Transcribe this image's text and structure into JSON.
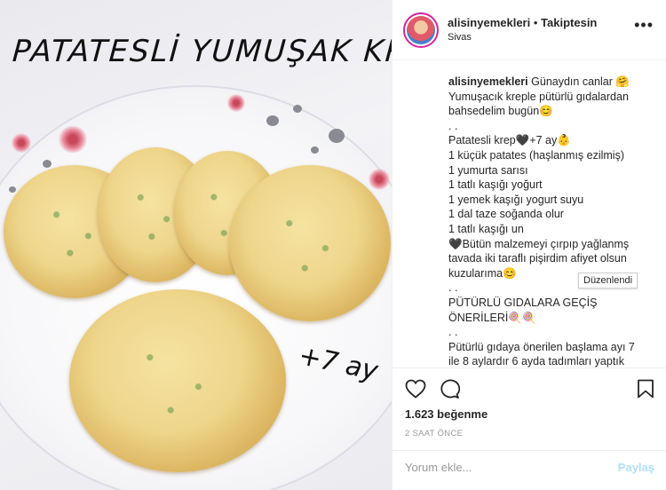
{
  "photo": {
    "title": "PATATESLİ YUMUŞAK KREP",
    "age_note": "+7 ay"
  },
  "post_header": {
    "username": "alisinyemekleri",
    "separator": "•",
    "follow_status": "Takiptesin",
    "location": "Sivas",
    "more_icon": "more-dots-icon"
  },
  "caption": {
    "username": "alisinyemekleri",
    "lines": [
      "Günaydın canlar 🤗",
      "Yumuşacık kreple pütürlü gıdalardan",
      "bahsedelim bugün😊",
      ". .",
      "Patatesli krep🖤+7 ay👶",
      "1 küçük patates (haşlanmış ezilmiş)",
      "1 yumurta sarısı",
      "1 tatlı kaşığı yoğurt",
      "1 yemek kaşığı yogurt suyu",
      "1 dal taze soğanda olur",
      "1 tatlı kaşığı un",
      "🖤Bütün malzemeyi çırpıp yağlanmş",
      "tavada iki taraflı pişirdim afiyet olsun",
      "kuzularıma😊",
      ". .",
      "PÜTÜRLÜ GIDALARA GEÇİŞ",
      "ÖNERİLERİ🍭🍭",
      ". .",
      "Pütürlü gıdaya önerilen başlama ayı 7",
      "ile 8 aylardır 6 ayda tadımları yaptık"
    ]
  },
  "edited_badge": "Düzenlendi",
  "actions": {
    "like_icon": "heart-icon",
    "comment_icon": "comment-icon",
    "save_icon": "bookmark-icon",
    "likes_text": "1.623 beğenme",
    "timestamp": "2 SAAT ÖNCE"
  },
  "comment": {
    "placeholder": "Yorum ekle...",
    "post_label": "Paylaş"
  }
}
